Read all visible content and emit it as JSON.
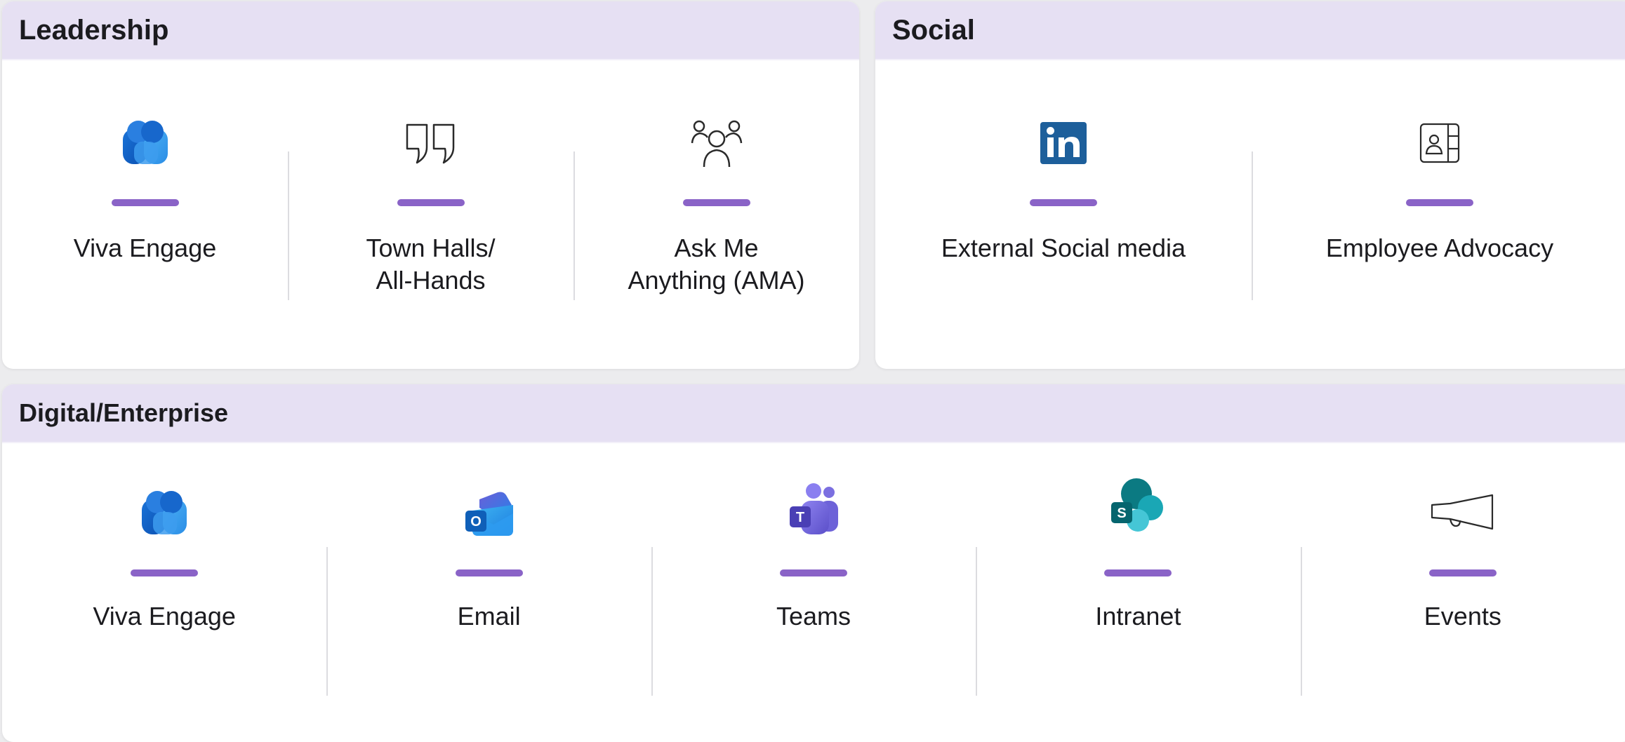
{
  "accent_color": "#8a63c7",
  "header_bg": "#e6e0f3",
  "panels": {
    "leadership": {
      "title": "Leadership",
      "items": [
        {
          "label": "Viva Engage",
          "icon": "viva-engage-icon"
        },
        {
          "label": "Town Halls/\nAll-Hands",
          "icon": "quote-icon"
        },
        {
          "label": "Ask Me\nAnything (AMA)",
          "icon": "people-group-icon"
        }
      ]
    },
    "social": {
      "title": "Social",
      "items": [
        {
          "label": "External Social media",
          "icon": "linkedin-icon"
        },
        {
          "label": "Employee Advocacy",
          "icon": "contact-card-icon"
        }
      ]
    },
    "digital": {
      "title": "Digital/Enterprise",
      "items": [
        {
          "label": "Viva Engage",
          "icon": "viva-engage-icon"
        },
        {
          "label": "Email",
          "icon": "outlook-icon"
        },
        {
          "label": "Teams",
          "icon": "teams-icon"
        },
        {
          "label": "Intranet",
          "icon": "sharepoint-icon"
        },
        {
          "label": "Events",
          "icon": "megaphone-icon"
        }
      ]
    }
  }
}
